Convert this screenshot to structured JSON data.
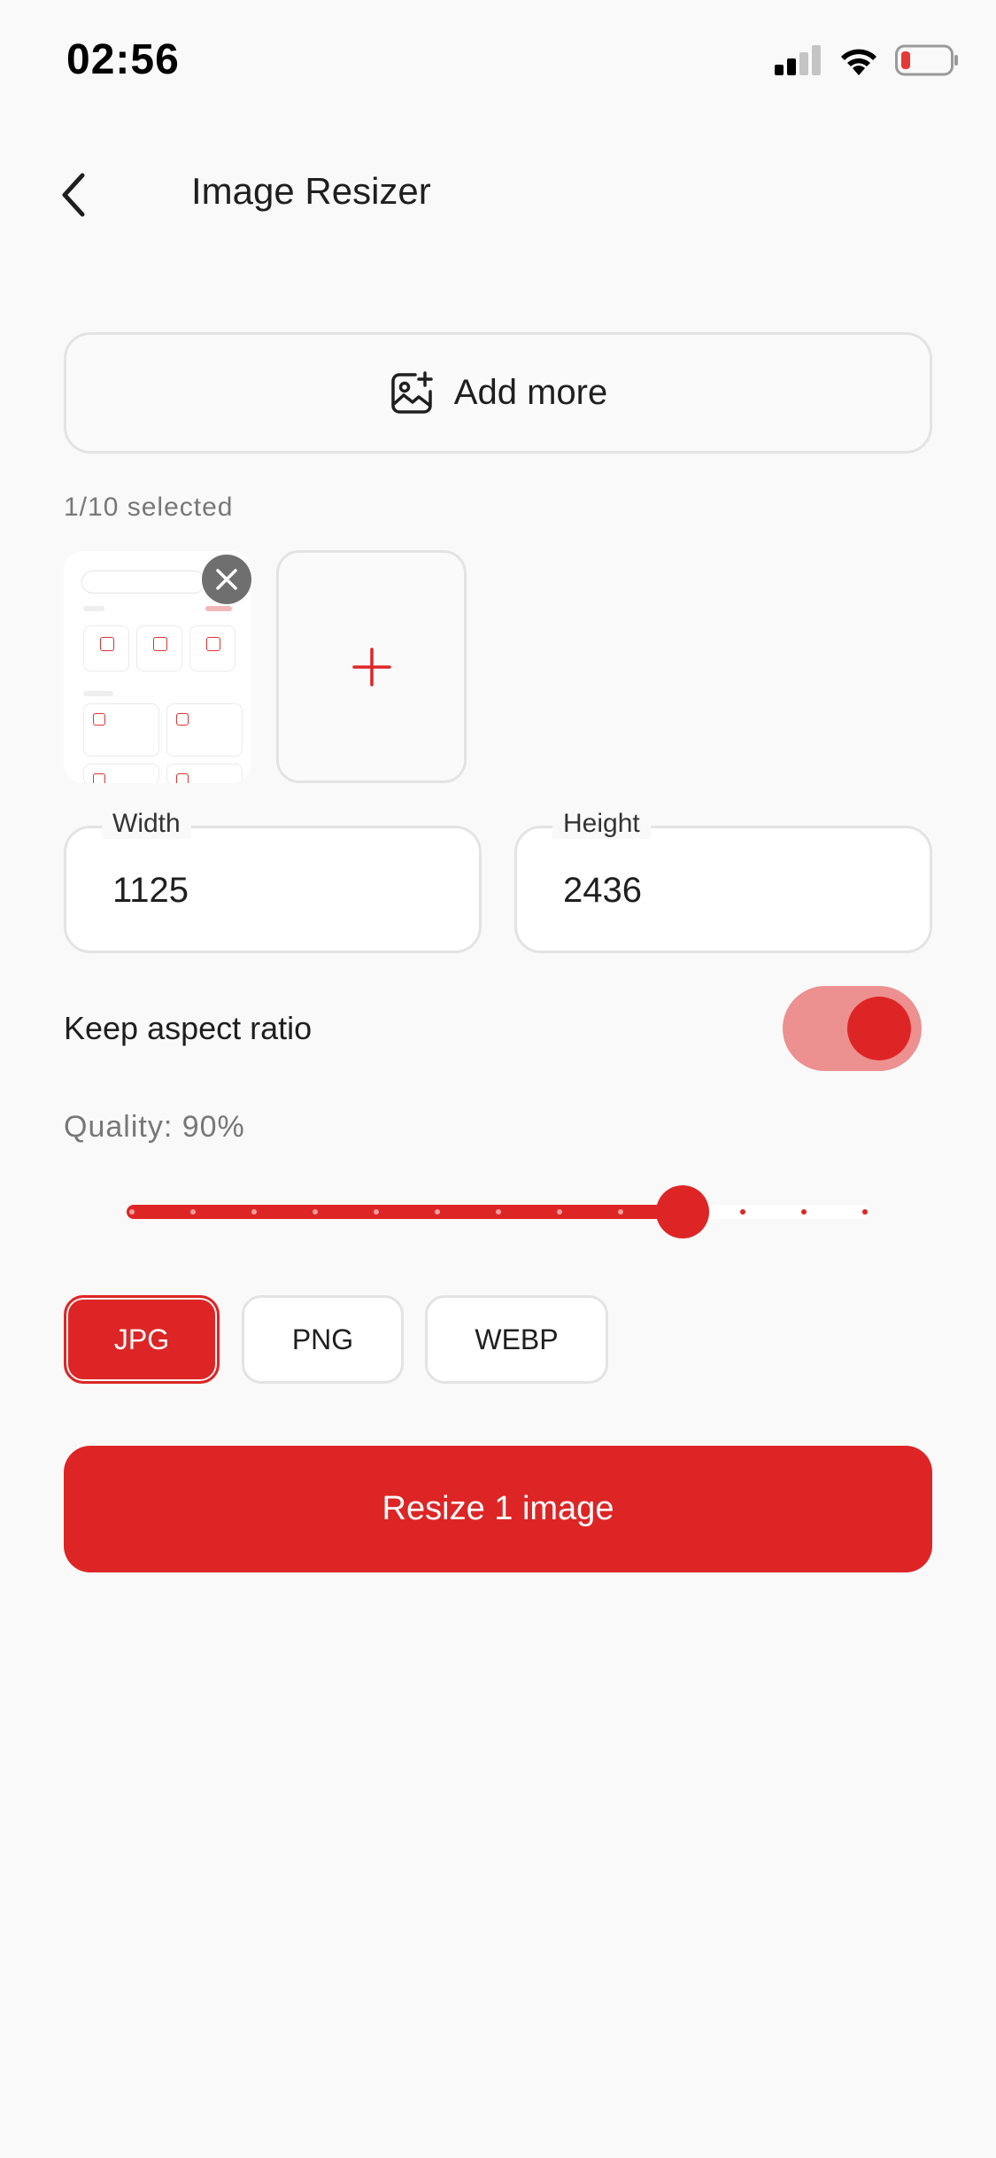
{
  "status_bar": {
    "time": "02:56"
  },
  "header": {
    "title": "Image Resizer"
  },
  "add_more": {
    "label": "Add more"
  },
  "selection": {
    "count_text": "1/10 selected"
  },
  "dimensions": {
    "width_label": "Width",
    "width_value": "1125",
    "height_label": "Height",
    "height_value": "2436"
  },
  "aspect_ratio": {
    "label": "Keep aspect ratio",
    "enabled": true
  },
  "quality": {
    "label": "Quality: 90%",
    "value": 90,
    "min": 0,
    "max": 100,
    "steps": 12
  },
  "formats": {
    "options": [
      "JPG",
      "PNG",
      "WEBP"
    ],
    "selected": "JPG"
  },
  "action": {
    "resize_label": "Resize 1 image"
  },
  "colors": {
    "accent": "#de2525",
    "accent_light": "#ec9090",
    "border": "#e3e3e3",
    "muted_text": "#777777"
  }
}
